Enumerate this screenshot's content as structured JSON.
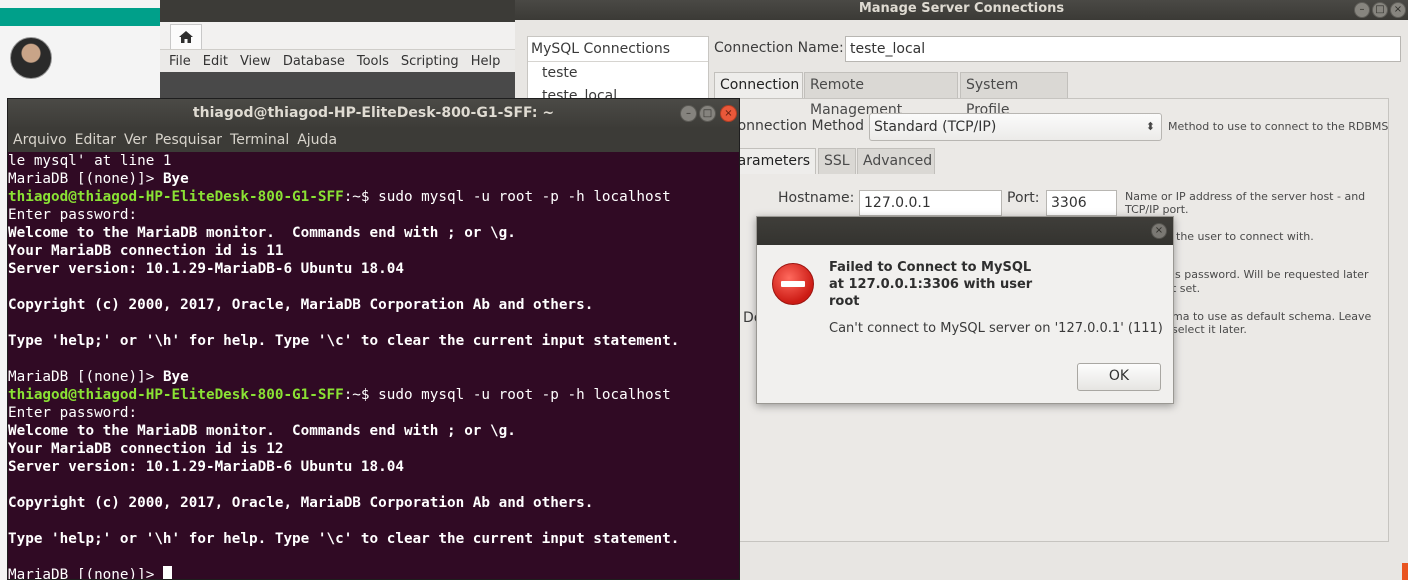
{
  "workbench": {
    "menu": [
      "File",
      "Edit",
      "View",
      "Database",
      "Tools",
      "Scripting",
      "Help"
    ]
  },
  "manage_connections": {
    "title": "Manage Server Connections",
    "list_header": "MySQL Connections",
    "connections": [
      "teste",
      "teste_local"
    ],
    "connection_name_label": "Connection Name:",
    "connection_name_value": "teste_local",
    "tabs": [
      "Connection",
      "Remote Management",
      "System Profile"
    ],
    "method_label": "Connection Method:",
    "method_value": "Standard (TCP/IP)",
    "method_hint": "Method to use to connect to the RDBMS",
    "subtabs": [
      "Parameters",
      "SSL",
      "Advanced"
    ],
    "hostname_label": "Hostname:",
    "hostname_value": "127.0.0.1",
    "port_label": "Port:",
    "port_value": "3306",
    "hint_host": "Name or IP address of the server host - and TCP/IP port.",
    "hint_user": "the user to connect with.",
    "hint_password_1": "'s password. Will be requested later",
    "hint_password_2": "t set.",
    "hint_schema_1": "ma to use as default schema. Leave",
    "hint_schema_2": "select it later.",
    "clipped_label": "De"
  },
  "error_dialog": {
    "heading": "Failed to Connect to MySQL at 127.0.0.1:3306 with user root",
    "message": "Can't connect to MySQL server on '127.0.0.1' (111)",
    "ok_label": "OK"
  },
  "terminal": {
    "title": "thiagod@thiagod-HP-EliteDesk-800-G1-SFF: ~",
    "menu": [
      "Arquivo",
      "Editar",
      "Ver",
      "Pesquisar",
      "Terminal",
      "Ajuda"
    ],
    "lines": [
      {
        "type": "plain",
        "text": "le mysql' at line 1"
      },
      {
        "type": "maria",
        "text": "MariaDB [(none)]> ",
        "bold": "Bye"
      },
      {
        "type": "prompt",
        "prompt": "thiagod@thiagod-HP-EliteDesk-800-G1-SFF",
        "rest": ":~$ sudo mysql -u root -p -h localhost"
      },
      {
        "type": "plain",
        "text": "Enter password:"
      },
      {
        "type": "bold",
        "text": "Welcome to the MariaDB monitor.  Commands end with ; or \\g."
      },
      {
        "type": "bold",
        "text": "Your MariaDB connection id is 11"
      },
      {
        "type": "bold",
        "text": "Server version: 10.1.29-MariaDB-6 Ubuntu 18.04"
      },
      {
        "type": "plain",
        "text": ""
      },
      {
        "type": "bold",
        "text": "Copyright (c) 2000, 2017, Oracle, MariaDB Corporation Ab and others."
      },
      {
        "type": "plain",
        "text": ""
      },
      {
        "type": "bold",
        "text": "Type 'help;' or '\\h' for help. Type '\\c' to clear the current input statement."
      },
      {
        "type": "plain",
        "text": ""
      },
      {
        "type": "maria",
        "text": "MariaDB [(none)]> ",
        "bold": "Bye"
      },
      {
        "type": "prompt",
        "prompt": "thiagod@thiagod-HP-EliteDesk-800-G1-SFF",
        "rest": ":~$ sudo mysql -u root -p -h localhost"
      },
      {
        "type": "plain",
        "text": "Enter password:"
      },
      {
        "type": "bold",
        "text": "Welcome to the MariaDB monitor.  Commands end with ; or \\g."
      },
      {
        "type": "bold",
        "text": "Your MariaDB connection id is 12"
      },
      {
        "type": "bold",
        "text": "Server version: 10.1.29-MariaDB-6 Ubuntu 18.04"
      },
      {
        "type": "plain",
        "text": ""
      },
      {
        "type": "bold",
        "text": "Copyright (c) 2000, 2017, Oracle, MariaDB Corporation Ab and others."
      },
      {
        "type": "plain",
        "text": ""
      },
      {
        "type": "bold",
        "text": "Type 'help;' or '\\h' for help. Type '\\c' to clear the current input statement."
      },
      {
        "type": "plain",
        "text": ""
      },
      {
        "type": "cursor",
        "text": "MariaDB [(none)]> "
      }
    ]
  },
  "colors": {
    "terminal_bg": "#300a24",
    "prompt_green": "#8ae234",
    "teal_bar": "#00a08a",
    "error_red": "#cc1b14"
  }
}
